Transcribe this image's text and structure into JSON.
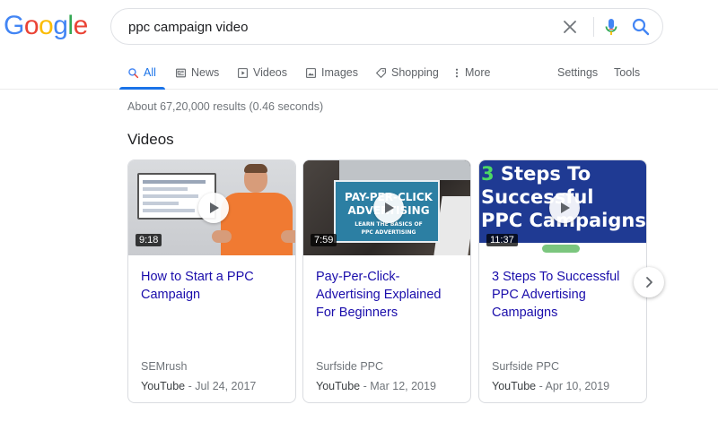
{
  "logo": {
    "letters": [
      {
        "ch": "G",
        "color": "#4285F4"
      },
      {
        "ch": "o",
        "color": "#EA4335"
      },
      {
        "ch": "o",
        "color": "#FBBC05"
      },
      {
        "ch": "g",
        "color": "#4285F4"
      },
      {
        "ch": "l",
        "color": "#34A853"
      },
      {
        "ch": "e",
        "color": "#EA4335"
      }
    ]
  },
  "search": {
    "query": "ppc campaign video",
    "clear_icon": "close-icon",
    "mic_icon": "mic-icon",
    "search_icon": "search-icon"
  },
  "tabs": {
    "all": "All",
    "news": "News",
    "videos": "Videos",
    "images": "Images",
    "shopping": "Shopping",
    "more": "More",
    "settings": "Settings",
    "tools": "Tools"
  },
  "results": {
    "stats": "About 67,20,000 results (0.46 seconds)",
    "section_title": "Videos"
  },
  "videos": [
    {
      "duration": "9:18",
      "title_lines": [
        "How to Start a PPC",
        "Campaign"
      ],
      "source": "SEMrush",
      "platform": "YouTube",
      "date": "- Jul 24, 2017"
    },
    {
      "duration": "7:59",
      "title_lines": [
        "Pay-Per-Click-",
        "Advertising Explained",
        "For Beginners"
      ],
      "source": "Surfside PPC",
      "platform": "YouTube",
      "date": "- Mar 12, 2019",
      "thumb_text": [
        "PAY-PER-CLICK",
        "ADVERTISING",
        "LEARN THE BASICS OF",
        "PPC ADVERTISING"
      ]
    },
    {
      "duration": "11:37",
      "title_lines": [
        "3 Steps To Successful",
        "PPC Advertising",
        "Campaigns"
      ],
      "source": "Surfside PPC",
      "platform": "YouTube",
      "date": "- Apr 10, 2019",
      "thumb_text": [
        "3",
        " Steps To",
        "Successful",
        "PPC Campaigns"
      ]
    }
  ],
  "colors": {
    "accent": "#1a73e8",
    "link": "#1a0dab",
    "muted": "#70757a"
  }
}
